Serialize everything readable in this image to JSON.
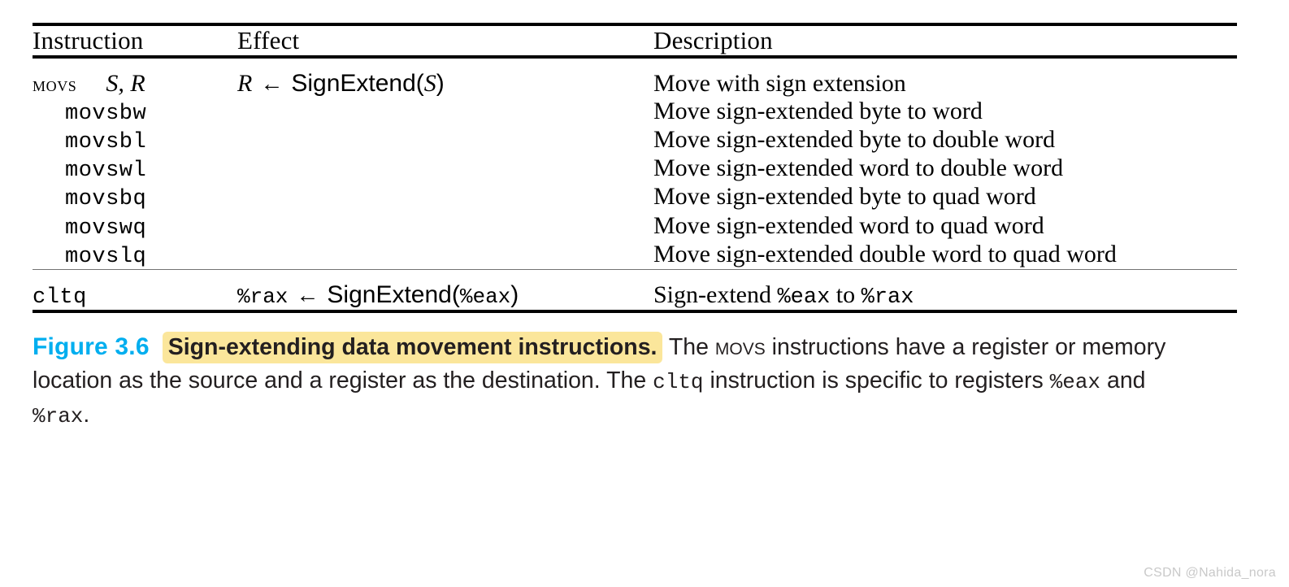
{
  "figure": {
    "columns": [
      "Instruction",
      "Effect",
      "Description"
    ],
    "rows": [
      {
        "instruction_mnemonic": "movs",
        "instruction_mnemonic_style": "smallcaps",
        "instruction_operands": "S, R",
        "effect_dest": "R",
        "effect_arrow": "←",
        "effect_fn": "SignExtend(",
        "effect_arg": "S",
        "effect_close": ")",
        "description": "Move with sign extension"
      },
      {
        "instruction_mnemonic": "movsbw",
        "instruction_mnemonic_style": "mono",
        "instruction_operands": "",
        "effect_dest": "",
        "effect_arrow": "",
        "effect_fn": "",
        "effect_arg": "",
        "effect_close": "",
        "description": "Move sign-extended byte to word"
      },
      {
        "instruction_mnemonic": "movsbl",
        "instruction_mnemonic_style": "mono",
        "instruction_operands": "",
        "effect_dest": "",
        "effect_arrow": "",
        "effect_fn": "",
        "effect_arg": "",
        "effect_close": "",
        "description": "Move sign-extended byte to double word"
      },
      {
        "instruction_mnemonic": "movswl",
        "instruction_mnemonic_style": "mono",
        "instruction_operands": "",
        "effect_dest": "",
        "effect_arrow": "",
        "effect_fn": "",
        "effect_arg": "",
        "effect_close": "",
        "description": "Move sign-extended word to double word"
      },
      {
        "instruction_mnemonic": "movsbq",
        "instruction_mnemonic_style": "mono",
        "instruction_operands": "",
        "effect_dest": "",
        "effect_arrow": "",
        "effect_fn": "",
        "effect_arg": "",
        "effect_close": "",
        "description": "Move sign-extended byte to quad word"
      },
      {
        "instruction_mnemonic": "movswq",
        "instruction_mnemonic_style": "mono",
        "instruction_operands": "",
        "effect_dest": "",
        "effect_arrow": "",
        "effect_fn": "",
        "effect_arg": "",
        "effect_close": "",
        "description": "Move sign-extended word to quad word"
      },
      {
        "instruction_mnemonic": "movslq",
        "instruction_mnemonic_style": "mono",
        "instruction_operands": "",
        "effect_dest": "",
        "effect_arrow": "",
        "effect_fn": "",
        "effect_arg": "",
        "effect_close": "",
        "description": "Move sign-extended double word to quad word"
      }
    ],
    "last_row": {
      "instruction_mnemonic": "cltq",
      "effect_dest": "%rax",
      "effect_arrow": "←",
      "effect_fn": "SignExtend(",
      "effect_arg": "%eax",
      "effect_close": ")",
      "description_prefix": "Sign-extend ",
      "description_reg1": "%eax",
      "description_middle": " to ",
      "description_reg2": "%rax"
    }
  },
  "caption": {
    "label": "Figure 3.6",
    "title": "Sign-extending data movement instructions.",
    "body_part1": "The ",
    "body_smallcaps": "movs",
    "body_part2": " instructions have a register or memory location as the source and a register as the destination. The ",
    "body_mono1": "cltq",
    "body_part3": " instruction is specific to registers ",
    "body_mono2": "%eax",
    "body_part4": " and ",
    "body_mono3": "%rax",
    "body_part5": "."
  },
  "watermark": "CSDN @Nahida_nora",
  "colors": {
    "figure_label": "#00aeef",
    "highlight": "#fbe69b",
    "text": "#231f20",
    "rule": "#000000",
    "watermark": "#c9c9c9"
  }
}
